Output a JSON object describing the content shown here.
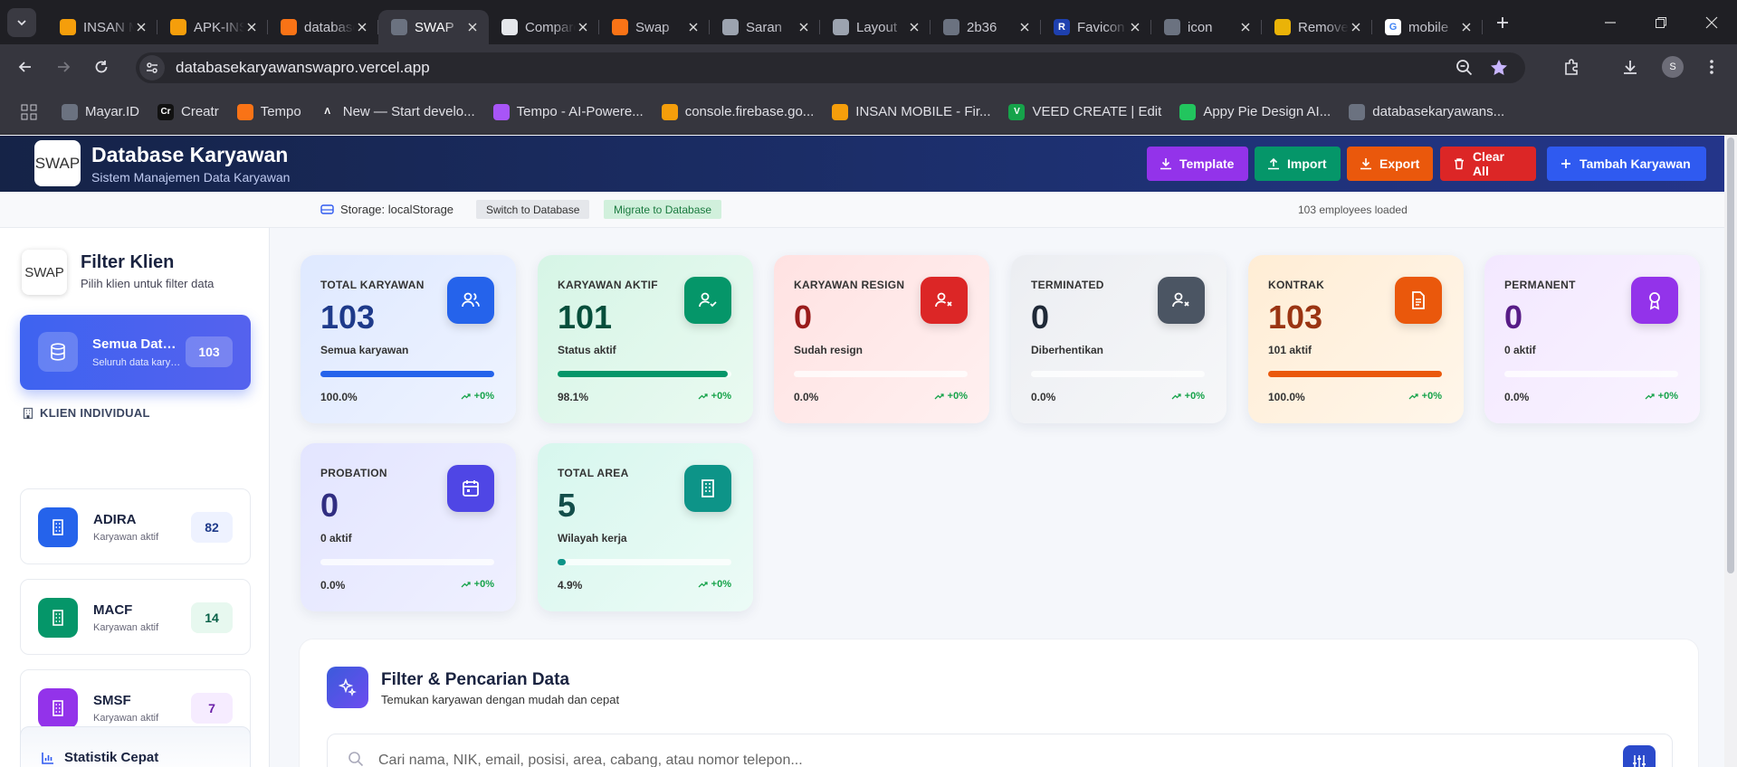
{
  "browser": {
    "tabs": [
      {
        "label": "INSAN MOBILE",
        "icon": "firebase-icon",
        "active": false
      },
      {
        "label": "APK-INSAN",
        "icon": "firebase-icon",
        "active": false
      },
      {
        "label": "database",
        "icon": "tempo-icon",
        "active": false
      },
      {
        "label": "SWAP",
        "icon": "globe-icon",
        "active": true
      },
      {
        "label": "Compare",
        "icon": "github-icon",
        "active": false
      },
      {
        "label": "Swap",
        "icon": "tempo-icon",
        "active": false
      },
      {
        "label": "Saran",
        "icon": "openai-icon",
        "active": false
      },
      {
        "label": "Layout",
        "icon": "openai-icon",
        "active": false
      },
      {
        "label": "2b36",
        "icon": "globe-icon",
        "active": false
      },
      {
        "label": "Favicon",
        "icon": "r-logo-icon",
        "active": false
      },
      {
        "label": "icon",
        "icon": "globe-icon",
        "active": false
      },
      {
        "label": "Remove",
        "icon": "layers-icon",
        "active": false
      },
      {
        "label": "mobile",
        "icon": "google-icon",
        "active": false
      }
    ],
    "url": "databasekaryawanswapro.vercel.app",
    "profile_initial": "S",
    "bookmarks": [
      {
        "label": "Mayar.ID",
        "icon": "globe-icon"
      },
      {
        "label": "Creatr",
        "icon": "creatr-icon"
      },
      {
        "label": "Tempo",
        "icon": "tempo-icon"
      },
      {
        "label": "New — Start develo...",
        "icon": "vercel-icon"
      },
      {
        "label": "Tempo - AI-Powere...",
        "icon": "figma-icon"
      },
      {
        "label": "console.firebase.go...",
        "icon": "firebase-icon"
      },
      {
        "label": "INSAN MOBILE - Fir...",
        "icon": "firebase-icon"
      },
      {
        "label": "VEED CREATE | Edit",
        "icon": "veed-icon"
      },
      {
        "label": "Appy Pie Design AI...",
        "icon": "appypie-icon"
      },
      {
        "label": "databasekaryawans...",
        "icon": "globe-icon"
      }
    ]
  },
  "header": {
    "logo_alt": "SWAP",
    "title": "Database Karyawan",
    "subtitle": "Sistem Manajemen Data Karyawan",
    "buttons": {
      "template": "Template",
      "import": "Import",
      "export": "Export",
      "clear_all": "Clear All",
      "add": "Tambah Karyawan"
    }
  },
  "storage": {
    "label": "Storage: localStorage",
    "switch": "Switch to Database",
    "migrate": "Migrate to Database",
    "count": "103 employees loaded"
  },
  "sidebar": {
    "logo_alt": "SWAP",
    "title": "Filter Klien",
    "subtitle": "Pilih klien untuk filter data",
    "all": {
      "title": "Semua Data Klien",
      "subtitle": "Seluruh data karyawan",
      "count": "103"
    },
    "section_label": "KLIEN INDIVIDUAL",
    "clients": [
      {
        "name": "ADIRA",
        "sub": "Karyawan aktif",
        "count": "82"
      },
      {
        "name": "MACF",
        "sub": "Karyawan aktif",
        "count": "14"
      },
      {
        "name": "SMSF",
        "sub": "Karyawan aktif",
        "count": "7"
      }
    ],
    "stats_title": "Statistik Cepat"
  },
  "cards": [
    {
      "label": "TOTAL KARYAWAN",
      "value": "103",
      "desc": "Semua karyawan",
      "pct": "100.0%",
      "fill": 1.0,
      "trend": "+0%",
      "accent": "#2563eb"
    },
    {
      "label": "KARYAWAN AKTIF",
      "value": "101",
      "desc": "Status aktif",
      "pct": "98.1%",
      "fill": 0.981,
      "trend": "+0%",
      "accent": "#059669"
    },
    {
      "label": "KARYAWAN RESIGN",
      "value": "0",
      "desc": "Sudah resign",
      "pct": "0.0%",
      "fill": 0,
      "trend": "+0%",
      "accent": "#dc2626"
    },
    {
      "label": "TERMINATED",
      "value": "0",
      "desc": "Diberhentikan",
      "pct": "0.0%",
      "fill": 0,
      "trend": "+0%",
      "accent": "#4b5563"
    },
    {
      "label": "KONTRAK",
      "value": "103",
      "desc": "101 aktif",
      "pct": "100.0%",
      "fill": 1.0,
      "trend": "+0%",
      "accent": "#ea580c"
    },
    {
      "label": "PERMANENT",
      "value": "0",
      "desc": "0 aktif",
      "pct": "0.0%",
      "fill": 0,
      "trend": "+0%",
      "accent": "#9333ea"
    },
    {
      "label": "PROBATION",
      "value": "0",
      "desc": "0 aktif",
      "pct": "0.0%",
      "fill": 0,
      "trend": "+0%",
      "accent": "#4f46e5"
    },
    {
      "label": "TOTAL AREA",
      "value": "5",
      "desc": "Wilayah kerja",
      "pct": "4.9%",
      "fill": 0.049,
      "trend": "+0%",
      "accent": "#0d9488"
    }
  ],
  "filter": {
    "title": "Filter & Pencarian Data",
    "subtitle": "Temukan karyawan dengan mudah dan cepat",
    "search_placeholder": "Cari nama, NIK, email, posisi, area, cabang, atau nomor telepon..."
  }
}
